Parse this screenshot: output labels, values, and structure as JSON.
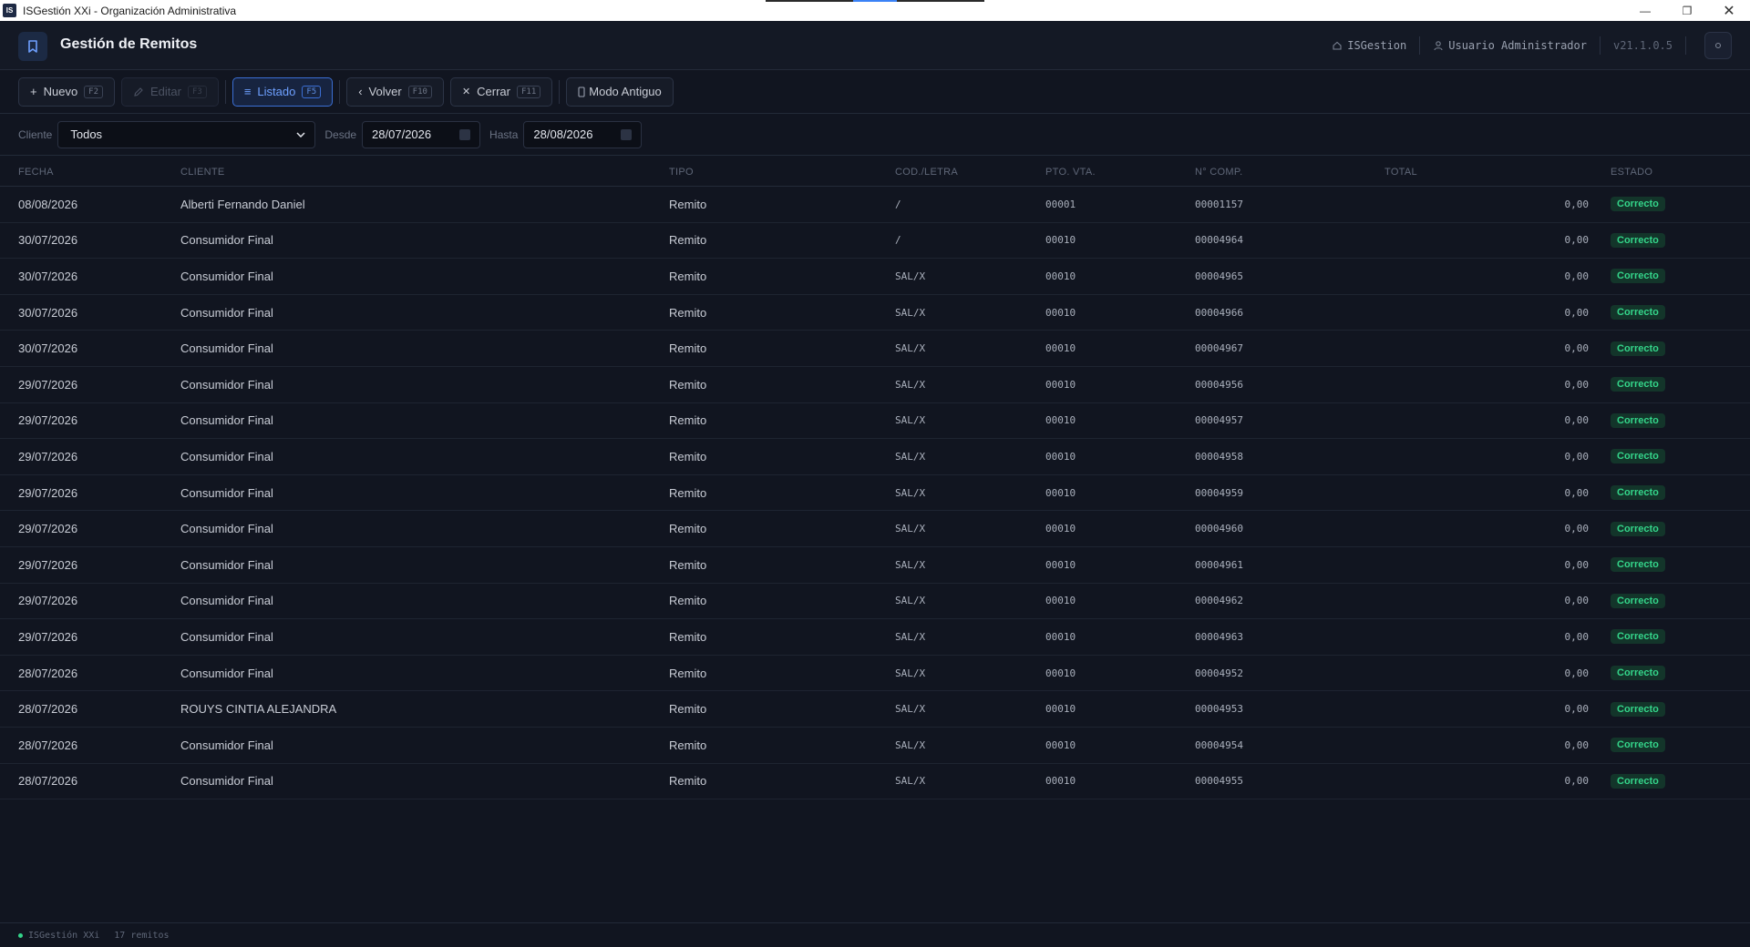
{
  "window": {
    "title": "ISGestión XXi - Organización Administrativa",
    "icon_text": "IS"
  },
  "header": {
    "title": "Gestión de Remitos",
    "company": "ISGestion",
    "user": "Usuario Administrador",
    "version": "v21.1.0.5"
  },
  "toolbar": {
    "nuevo": {
      "label": "Nuevo",
      "key": "F2"
    },
    "editar": {
      "label": "Editar",
      "key": "F3"
    },
    "listado": {
      "label": "Listado",
      "key": "F5"
    },
    "volver": {
      "label": "Volver",
      "key": "F10"
    },
    "cerrar": {
      "label": "Cerrar",
      "key": "F11"
    },
    "modo_antiguo": {
      "label": "Modo Antiguo"
    }
  },
  "filters": {
    "cliente_label": "Cliente",
    "cliente_value": "Todos",
    "desde_label": "Desde",
    "desde_value": "28/07/2026",
    "hasta_label": "Hasta",
    "hasta_value": "28/08/2026"
  },
  "table": {
    "columns": [
      "FECHA",
      "CLIENTE",
      "TIPO",
      "COD./LETRA",
      "PTO. VTA.",
      "N° COMP.",
      "TOTAL",
      "ESTADO"
    ],
    "rows": [
      {
        "fecha": "08/08/2026",
        "cliente": "Alberti Fernando Daniel",
        "tipo": "Remito",
        "cod": "/",
        "pto": "00001",
        "comp": "00001157",
        "total": "0,00",
        "estado": "Correcto"
      },
      {
        "fecha": "30/07/2026",
        "cliente": "Consumidor Final",
        "tipo": "Remito",
        "cod": "/",
        "pto": "00010",
        "comp": "00004964",
        "total": "0,00",
        "estado": "Correcto"
      },
      {
        "fecha": "30/07/2026",
        "cliente": "Consumidor Final",
        "tipo": "Remito",
        "cod": "SAL/X",
        "pto": "00010",
        "comp": "00004965",
        "total": "0,00",
        "estado": "Correcto"
      },
      {
        "fecha": "30/07/2026",
        "cliente": "Consumidor Final",
        "tipo": "Remito",
        "cod": "SAL/X",
        "pto": "00010",
        "comp": "00004966",
        "total": "0,00",
        "estado": "Correcto"
      },
      {
        "fecha": "30/07/2026",
        "cliente": "Consumidor Final",
        "tipo": "Remito",
        "cod": "SAL/X",
        "pto": "00010",
        "comp": "00004967",
        "total": "0,00",
        "estado": "Correcto"
      },
      {
        "fecha": "29/07/2026",
        "cliente": "Consumidor Final",
        "tipo": "Remito",
        "cod": "SAL/X",
        "pto": "00010",
        "comp": "00004956",
        "total": "0,00",
        "estado": "Correcto"
      },
      {
        "fecha": "29/07/2026",
        "cliente": "Consumidor Final",
        "tipo": "Remito",
        "cod": "SAL/X",
        "pto": "00010",
        "comp": "00004957",
        "total": "0,00",
        "estado": "Correcto"
      },
      {
        "fecha": "29/07/2026",
        "cliente": "Consumidor Final",
        "tipo": "Remito",
        "cod": "SAL/X",
        "pto": "00010",
        "comp": "00004958",
        "total": "0,00",
        "estado": "Correcto"
      },
      {
        "fecha": "29/07/2026",
        "cliente": "Consumidor Final",
        "tipo": "Remito",
        "cod": "SAL/X",
        "pto": "00010",
        "comp": "00004959",
        "total": "0,00",
        "estado": "Correcto"
      },
      {
        "fecha": "29/07/2026",
        "cliente": "Consumidor Final",
        "tipo": "Remito",
        "cod": "SAL/X",
        "pto": "00010",
        "comp": "00004960",
        "total": "0,00",
        "estado": "Correcto"
      },
      {
        "fecha": "29/07/2026",
        "cliente": "Consumidor Final",
        "tipo": "Remito",
        "cod": "SAL/X",
        "pto": "00010",
        "comp": "00004961",
        "total": "0,00",
        "estado": "Correcto"
      },
      {
        "fecha": "29/07/2026",
        "cliente": "Consumidor Final",
        "tipo": "Remito",
        "cod": "SAL/X",
        "pto": "00010",
        "comp": "00004962",
        "total": "0,00",
        "estado": "Correcto"
      },
      {
        "fecha": "29/07/2026",
        "cliente": "Consumidor Final",
        "tipo": "Remito",
        "cod": "SAL/X",
        "pto": "00010",
        "comp": "00004963",
        "total": "0,00",
        "estado": "Correcto"
      },
      {
        "fecha": "28/07/2026",
        "cliente": "Consumidor Final",
        "tipo": "Remito",
        "cod": "SAL/X",
        "pto": "00010",
        "comp": "00004952",
        "total": "0,00",
        "estado": "Correcto"
      },
      {
        "fecha": "28/07/2026",
        "cliente": "ROUYS CINTIA ALEJANDRA",
        "tipo": "Remito",
        "cod": "SAL/X",
        "pto": "00010",
        "comp": "00004953",
        "total": "0,00",
        "estado": "Correcto"
      },
      {
        "fecha": "28/07/2026",
        "cliente": "Consumidor Final",
        "tipo": "Remito",
        "cod": "SAL/X",
        "pto": "00010",
        "comp": "00004954",
        "total": "0,00",
        "estado": "Correcto"
      },
      {
        "fecha": "28/07/2026",
        "cliente": "Consumidor Final",
        "tipo": "Remito",
        "cod": "SAL/X",
        "pto": "00010",
        "comp": "00004955",
        "total": "0,00",
        "estado": "Correcto"
      }
    ]
  },
  "statusbar": {
    "app": "ISGestión XXi",
    "count": "17 remitos"
  },
  "colors": {
    "accent": "#3b6fd4",
    "success": "#34d58a",
    "background": "#111520"
  }
}
